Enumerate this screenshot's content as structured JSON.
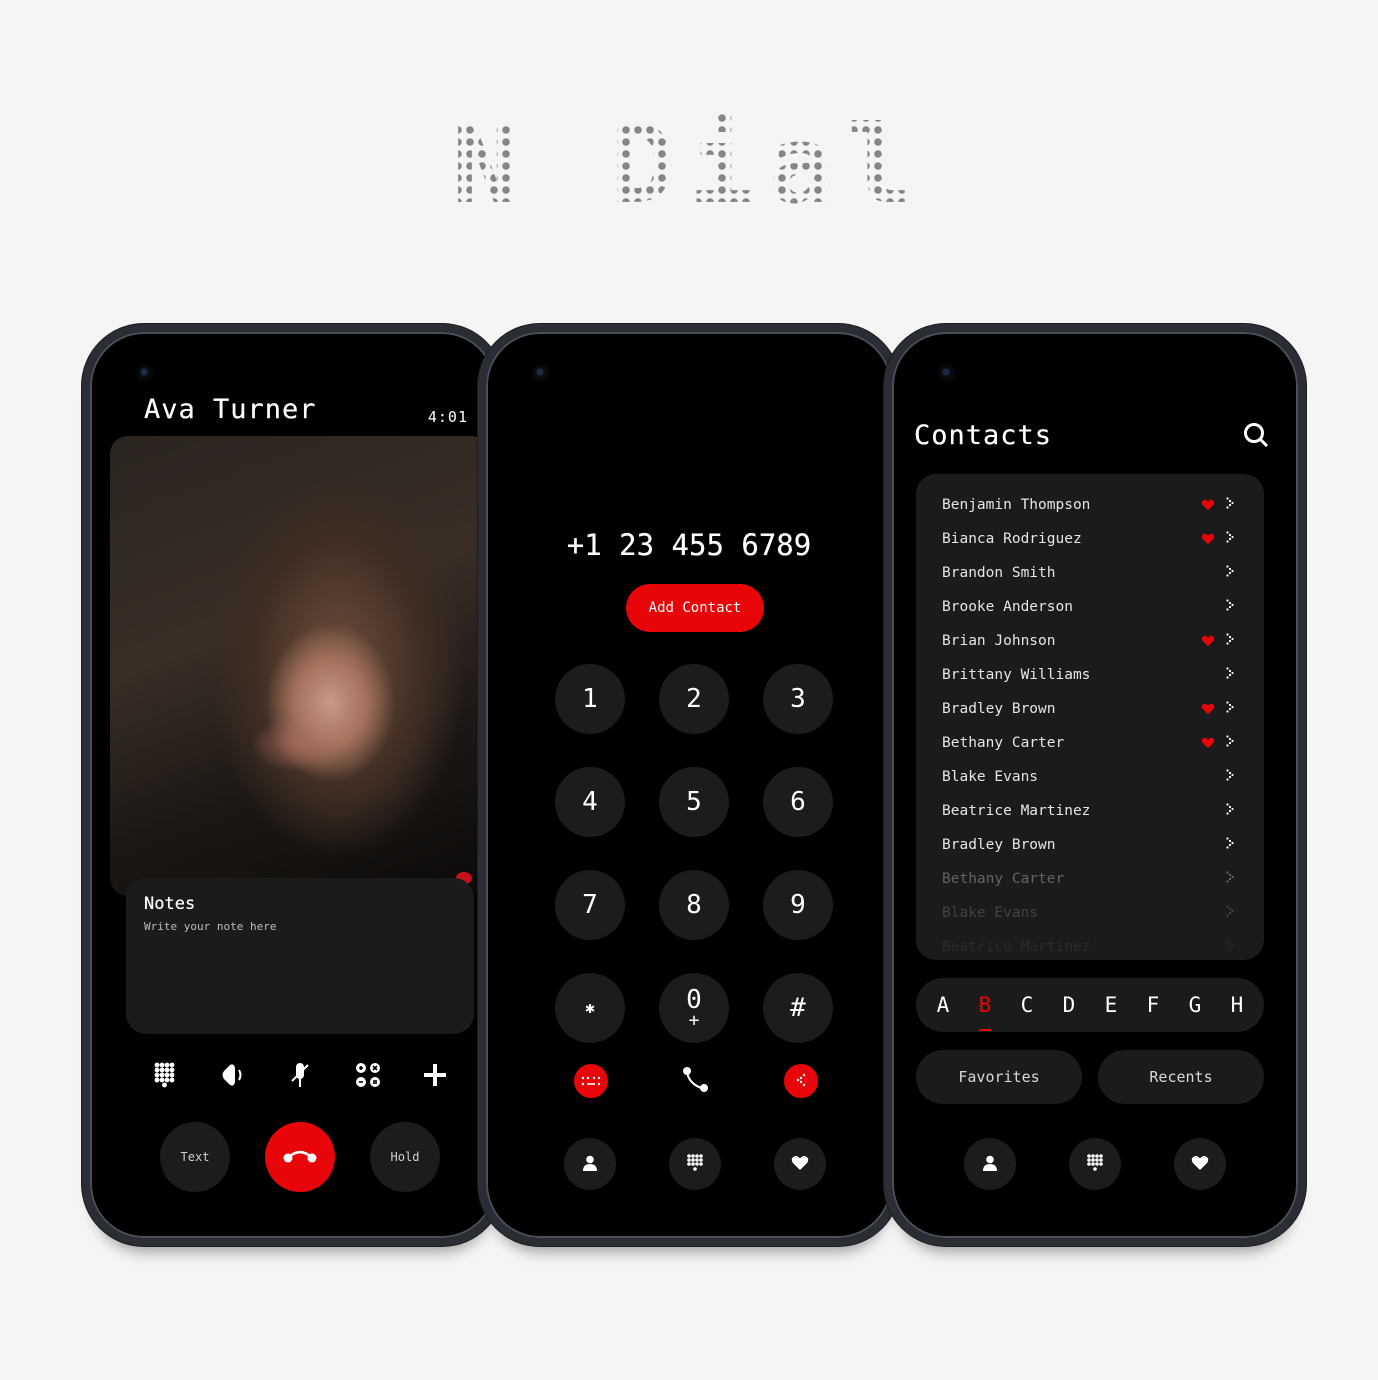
{
  "brand": {
    "title": "N Dial"
  },
  "call_screen": {
    "caller_name": "Ava Turner",
    "timer": "4:01",
    "notes": {
      "title": "Notes",
      "placeholder": "Write your note here"
    },
    "actions": [
      {
        "icon": "keypad-icon",
        "label": "Keypad"
      },
      {
        "icon": "speaker-icon",
        "label": "Speaker"
      },
      {
        "icon": "mute-icon",
        "label": "Mute"
      },
      {
        "icon": "merge-icon",
        "label": "Merge"
      },
      {
        "icon": "add-call-icon",
        "label": "Add call"
      }
    ],
    "text_label": "Text",
    "hold_label": "Hold",
    "end_call_icon": "end-call-icon",
    "accent_color": "#e8050a"
  },
  "dialer": {
    "number": "+1 23 455 6789",
    "add_contact_label": "Add Contact",
    "keys": [
      {
        "main": "1",
        "sub": ""
      },
      {
        "main": "2",
        "sub": ""
      },
      {
        "main": "3",
        "sub": ""
      },
      {
        "main": "4",
        "sub": ""
      },
      {
        "main": "5",
        "sub": ""
      },
      {
        "main": "6",
        "sub": ""
      },
      {
        "main": "7",
        "sub": ""
      },
      {
        "main": "8",
        "sub": ""
      },
      {
        "main": "9",
        "sub": ""
      },
      {
        "main": "✱",
        "sub": ""
      },
      {
        "main": "0",
        "sub": "+"
      },
      {
        "main": "#",
        "sub": ""
      }
    ],
    "actions": [
      "keyboard-icon",
      "call-icon",
      "backspace-icon"
    ],
    "nav": [
      "contacts-icon",
      "dialpad-icon",
      "favorites-icon"
    ]
  },
  "contacts": {
    "title": "Contacts",
    "search_icon": "search-icon",
    "list": [
      {
        "name": "Benjamin Thompson",
        "favorite": true
      },
      {
        "name": "Bianca Rodriguez",
        "favorite": true
      },
      {
        "name": "Brandon Smith",
        "favorite": false
      },
      {
        "name": "Brooke Anderson",
        "favorite": false
      },
      {
        "name": "Brian Johnson",
        "favorite": true
      },
      {
        "name": "Brittany Williams",
        "favorite": false
      },
      {
        "name": "Bradley Brown",
        "favorite": true
      },
      {
        "name": "Bethany Carter",
        "favorite": true
      },
      {
        "name": "Blake Evans",
        "favorite": false
      },
      {
        "name": "Beatrice Martinez",
        "favorite": false
      },
      {
        "name": "Bradley Brown",
        "favorite": false
      },
      {
        "name": "Bethany Carter",
        "favorite": false
      },
      {
        "name": "Blake Evans",
        "favorite": false
      },
      {
        "name": "Beatrice Martinez",
        "favorite": false
      }
    ],
    "alphabet": [
      "A",
      "B",
      "C",
      "D",
      "E",
      "F",
      "G",
      "H"
    ],
    "active_letter": "B",
    "tabs": {
      "favorites": "Favorites",
      "recents": "Recents"
    },
    "nav": [
      "contacts-icon",
      "dialpad-icon",
      "favorites-icon"
    ]
  }
}
